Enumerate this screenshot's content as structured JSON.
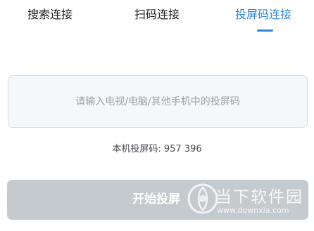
{
  "tabs": [
    {
      "label": "搜索连接",
      "active": false
    },
    {
      "label": "扫码连接",
      "active": false
    },
    {
      "label": "投屏码连接",
      "active": true
    }
  ],
  "accent_color": "#2f86d6",
  "code_input": {
    "value": "",
    "placeholder": "请输入电视/电脑/其他手机中的投屏码"
  },
  "local_code": {
    "label": "本机投屏码: 957 396"
  },
  "start_button": {
    "label": "开始投屏",
    "enabled": false
  },
  "watermark": {
    "logo_icon": "downxia-logo-icon",
    "name": "当下软件园",
    "url": "www.downxia.com"
  }
}
